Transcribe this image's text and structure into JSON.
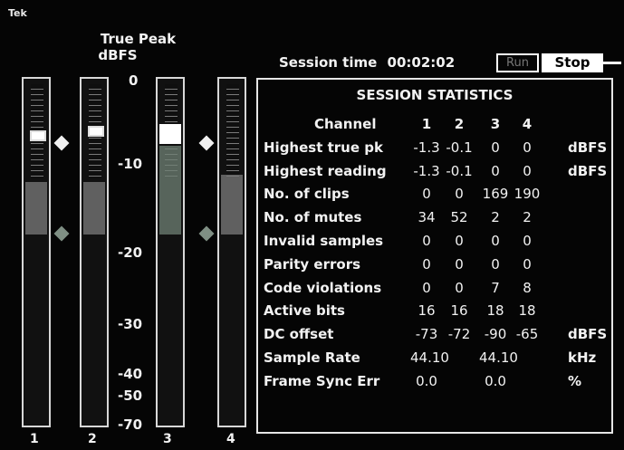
{
  "brand": "Tek",
  "meter_header": {
    "line1": "True Peak",
    "line2": "dBFS"
  },
  "scale_labels": [
    "0",
    "-10",
    "-20",
    "-30",
    "-40",
    "-50",
    "-70"
  ],
  "channels": [
    "1",
    "2",
    "3",
    "4"
  ],
  "session": {
    "label": "Session time",
    "value": "00:02:02",
    "record_label": "Run",
    "stop_label": "Stop"
  },
  "stats": {
    "title": "SESSION STATISTICS",
    "header": {
      "label": "Channel",
      "cols": [
        "1",
        "2",
        "3",
        "4"
      ]
    },
    "rows": [
      {
        "label": "Highest true pk",
        "values": [
          "-1.3",
          "-0.1",
          "0",
          "0"
        ],
        "unit": "dBFS"
      },
      {
        "label": "Highest reading",
        "values": [
          "-1.3",
          "-0.1",
          "0",
          "0"
        ],
        "unit": "dBFS"
      },
      {
        "label": "No. of clips",
        "values": [
          "0",
          "0",
          "169",
          "190"
        ],
        "unit": ""
      },
      {
        "label": "No. of mutes",
        "values": [
          "34",
          "52",
          "2",
          "2"
        ],
        "unit": ""
      },
      {
        "label": "Invalid samples",
        "values": [
          "0",
          "0",
          "0",
          "0"
        ],
        "unit": ""
      },
      {
        "label": "Parity errors",
        "values": [
          "0",
          "0",
          "0",
          "0"
        ],
        "unit": ""
      },
      {
        "label": "Code violations",
        "values": [
          "0",
          "0",
          "7",
          "8"
        ],
        "unit": ""
      },
      {
        "label": "Active bits",
        "values": [
          "16",
          "16",
          "18",
          "18"
        ],
        "unit": ""
      },
      {
        "label": "DC offset",
        "values": [
          "-73",
          "-72",
          "-90",
          "-65"
        ],
        "unit": "dBFS"
      },
      {
        "label": "Sample Rate",
        "values": [
          "44.10",
          "",
          "44.10",
          ""
        ],
        "unit": "kHz"
      },
      {
        "label": "Frame Sync Err",
        "values": [
          "0.0",
          "",
          "0.0",
          ""
        ],
        "unit": "%"
      }
    ]
  }
}
